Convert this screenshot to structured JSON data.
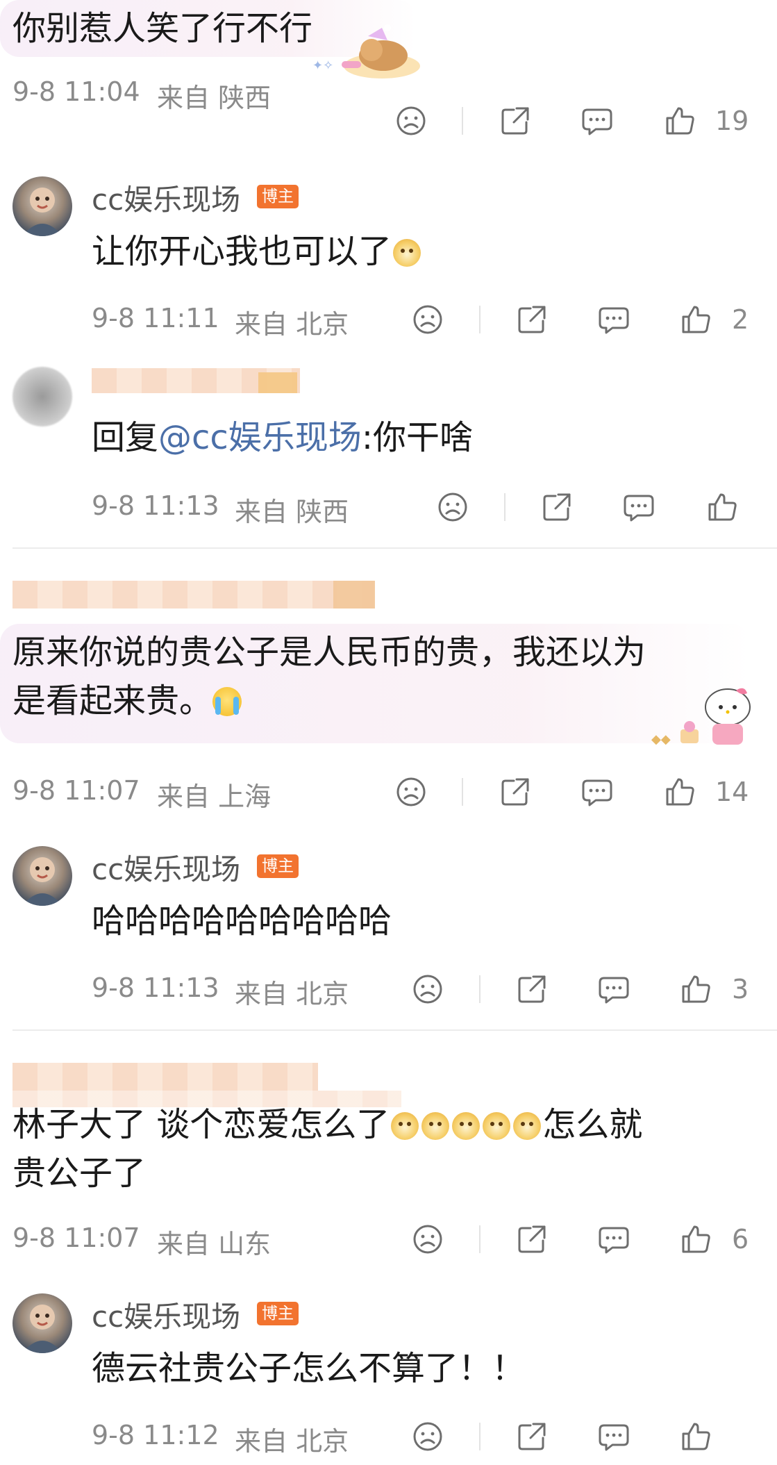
{
  "threads": [
    {
      "comment": {
        "text": "你别惹人笑了行不行",
        "date": "9-8 11:04",
        "location": "来自 陕西",
        "likes": "19"
      },
      "replies": [
        {
          "username": "cc娱乐现场",
          "badge": "博主",
          "text": "让你开心我也可以了",
          "date": "9-8 11:11",
          "location": "来自 北京",
          "likes": "2"
        },
        {
          "text_prefix": "回复",
          "mention": "@cc娱乐现场",
          "text_suffix": ":你干啥",
          "date": "9-8 11:13",
          "location": "来自 陕西",
          "likes": ""
        }
      ]
    },
    {
      "comment": {
        "line1": "原来你说的贵公子是人民币的贵，我还以为",
        "line2": "是看起来贵。",
        "date": "9-8 11:07",
        "location": "来自 上海",
        "likes": "14"
      },
      "replies": [
        {
          "username": "cc娱乐现场",
          "badge": "博主",
          "text": "哈哈哈哈哈哈哈哈哈",
          "date": "9-8 11:13",
          "location": "来自 北京",
          "likes": "3"
        }
      ]
    },
    {
      "comment": {
        "line1_a": "林子大了 谈个恋爱怎么了",
        "line1_b": "怎么就",
        "line2": "贵公子了",
        "date": "9-8 11:07",
        "location": "来自 山东",
        "likes": "6"
      },
      "replies": [
        {
          "username": "cc娱乐现场",
          "badge": "博主",
          "text": "德云社贵公子怎么不算了！！",
          "date": "9-8 11:12",
          "location": "来自 北京",
          "likes": ""
        }
      ]
    }
  ],
  "icons": {
    "dislike": "sad-face-icon",
    "share": "share-icon",
    "comment": "comment-icon",
    "like": "thumbs-up-icon"
  },
  "colors": {
    "badge": "#f2732f",
    "mention": "#4b6fa8",
    "meta": "#8a8a8a"
  }
}
